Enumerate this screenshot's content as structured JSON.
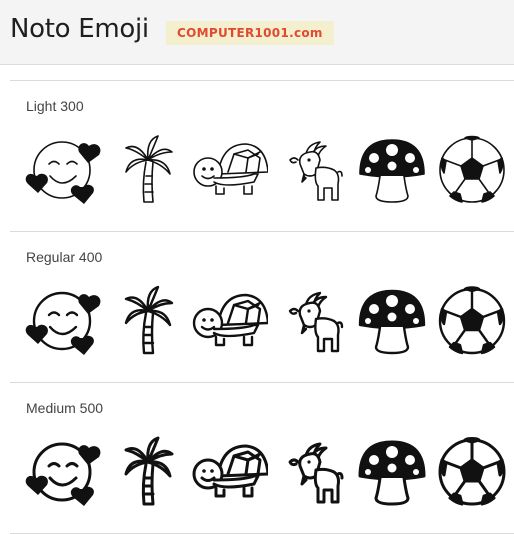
{
  "header": {
    "title": "Noto Emoji",
    "badge": "COMPUTER1001.com"
  },
  "sections": [
    {
      "label": "Light 300",
      "weight": 300
    },
    {
      "label": "Regular 400",
      "weight": 400
    },
    {
      "label": "Medium 500",
      "weight": 500
    }
  ],
  "emoji_icons": [
    "smiling-face-with-hearts-icon",
    "palm-tree-icon",
    "turtle-icon",
    "goat-icon",
    "mushroom-icon",
    "soccer-ball-icon"
  ],
  "colors": {
    "header_bg": "#f4f4f4",
    "badge_bg": "#f3efcf",
    "badge_text": "#e24a2f",
    "ink": "#111111"
  }
}
